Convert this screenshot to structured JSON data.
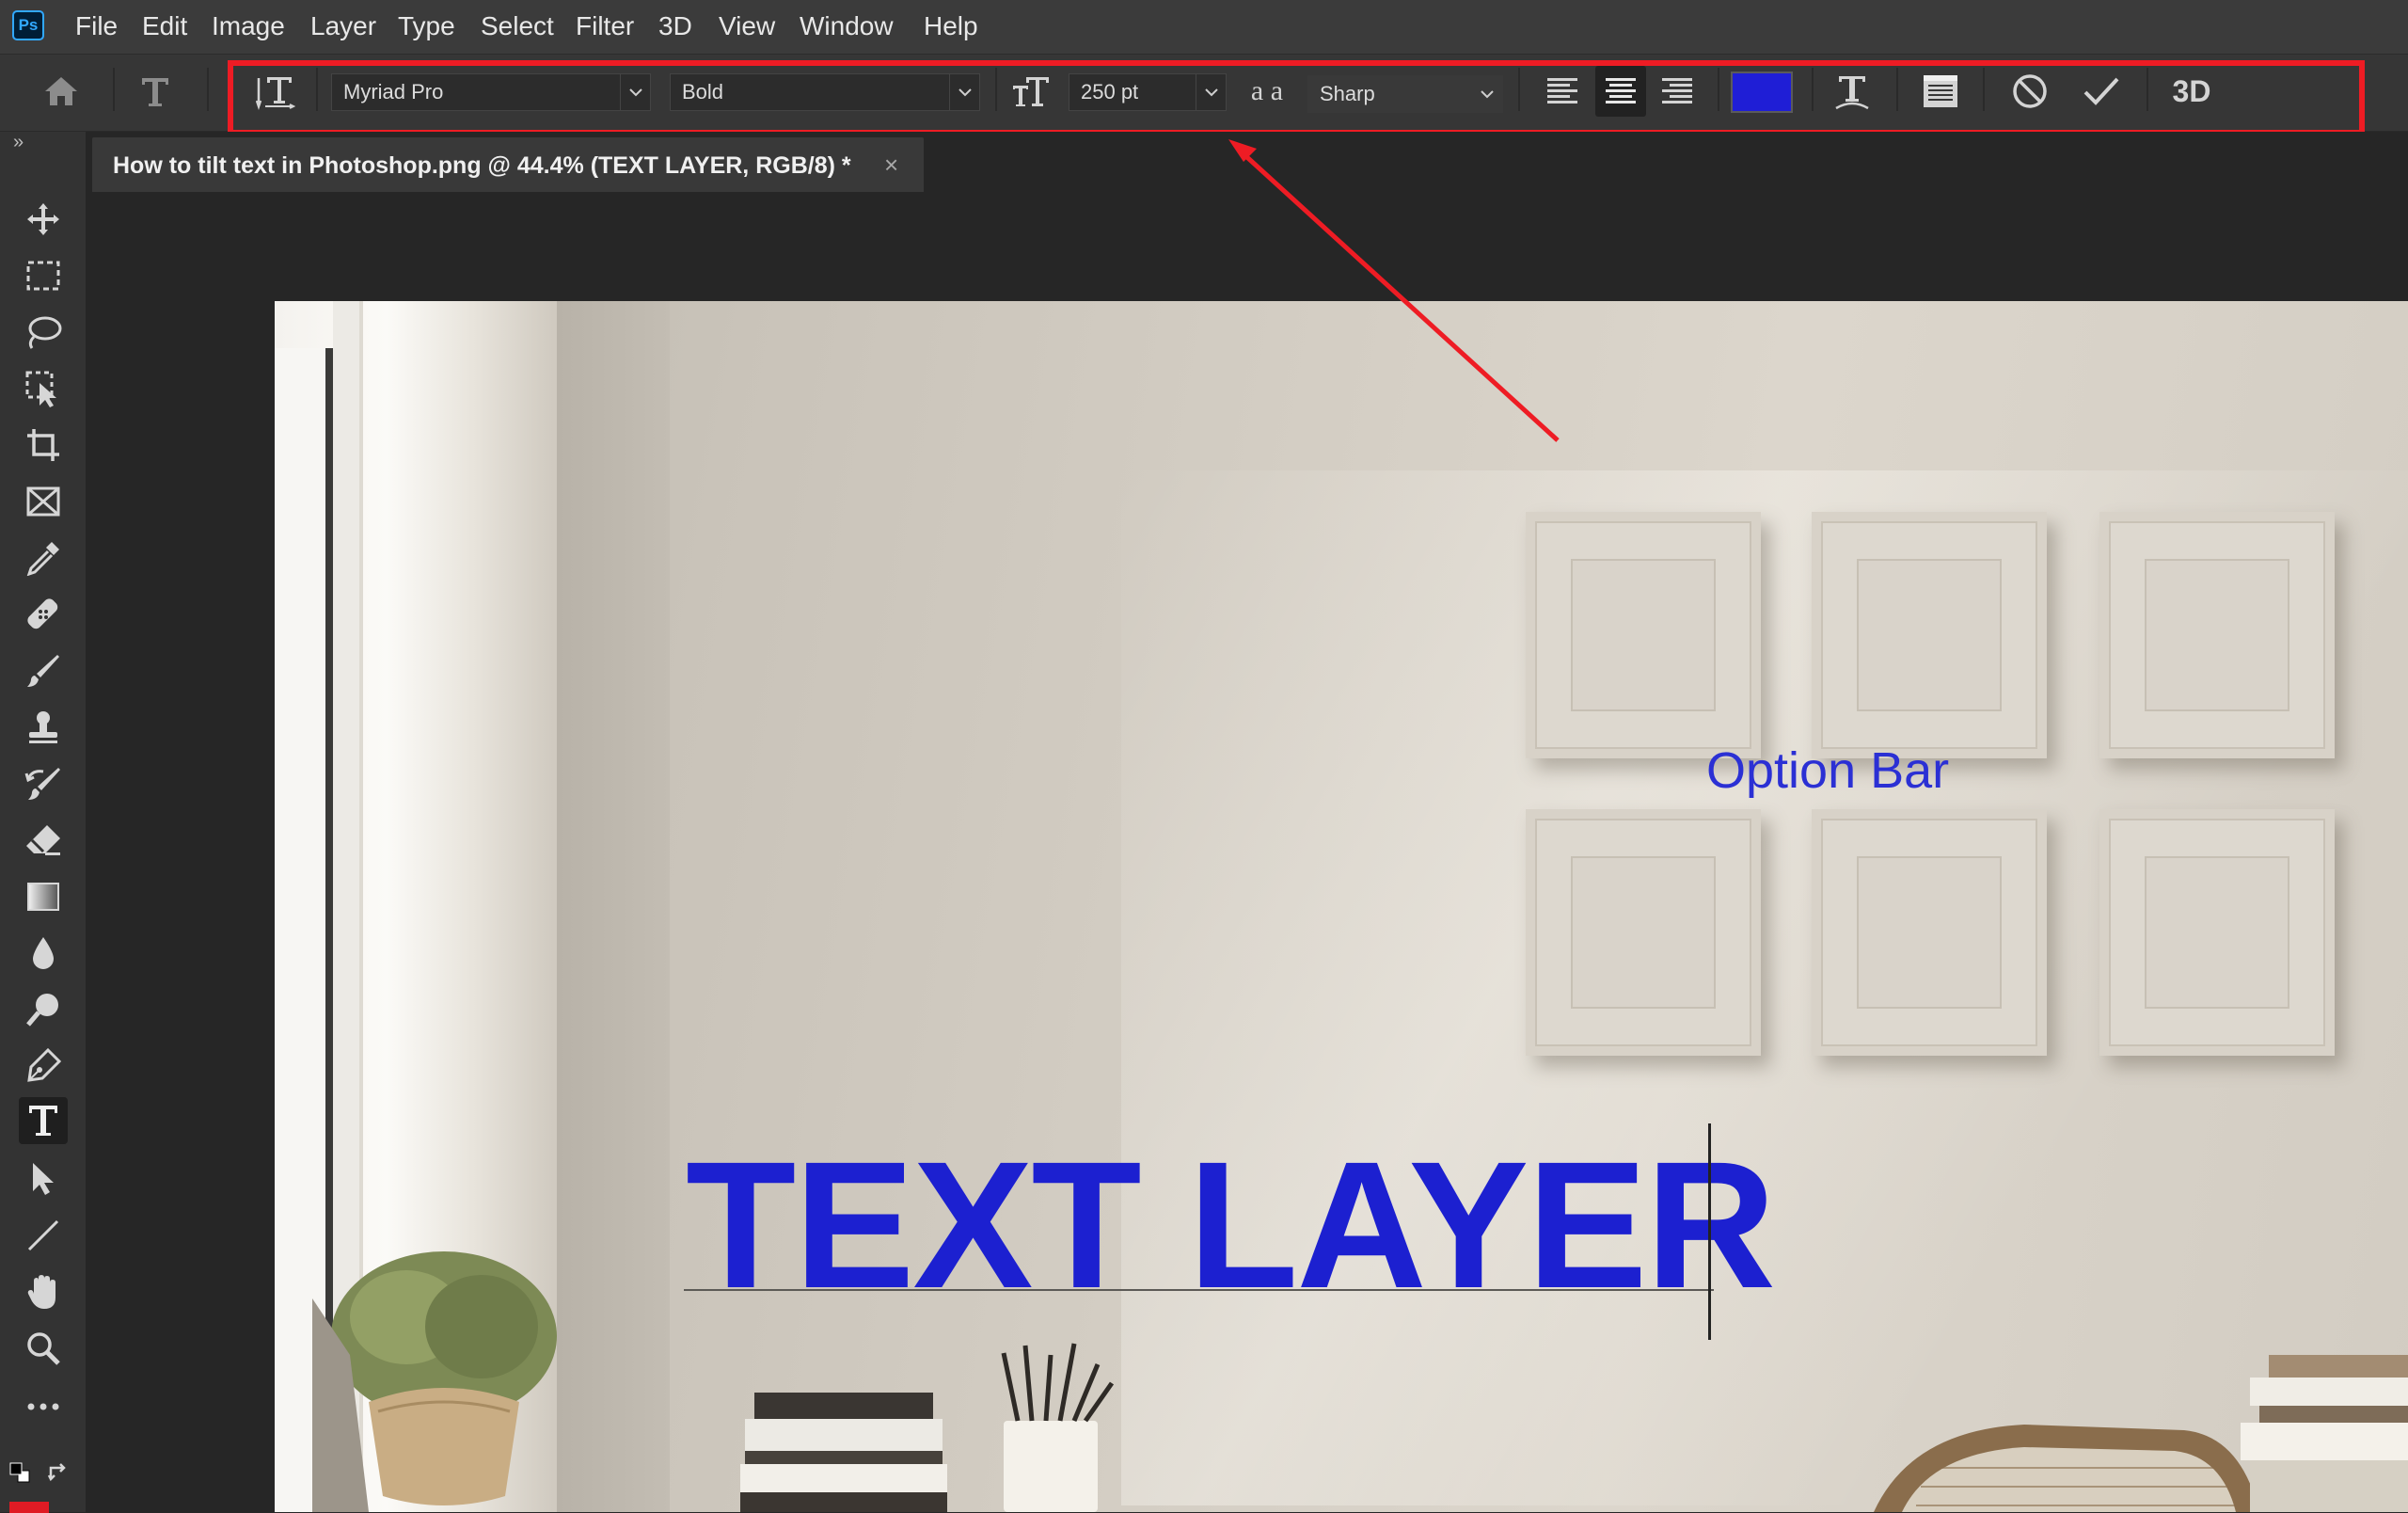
{
  "app": {
    "logo_text": "Ps"
  },
  "menu": {
    "items": [
      "File",
      "Edit",
      "Image",
      "Layer",
      "Type",
      "Select",
      "Filter",
      "3D",
      "View",
      "Window",
      "Help"
    ]
  },
  "options_bar": {
    "font_family": "Myriad Pro",
    "font_style": "Bold",
    "font_size": "250 pt",
    "antialias_icon_text": "a a",
    "antialias": "Sharp",
    "text_color": "#1f1ed6",
    "threed_label": "3D"
  },
  "tools": [
    "move-tool",
    "rectangular-marquee-tool",
    "lasso-tool",
    "object-selection-tool",
    "crop-tool",
    "frame-tool",
    "eyedropper-tool",
    "healing-brush-tool",
    "brush-tool",
    "clone-stamp-tool",
    "history-brush-tool",
    "eraser-tool",
    "gradient-tool",
    "blur-tool",
    "dodge-tool",
    "pen-tool",
    "type-tool",
    "path-selection-tool",
    "line-tool",
    "hand-tool",
    "zoom-tool",
    "more-tools"
  ],
  "document": {
    "tab_title": "How to tilt text in Photoshop.png @ 44.4% (TEXT LAYER, RGB/8) *",
    "close_glyph": "×"
  },
  "canvas": {
    "text_layer": "TEXT LAYER",
    "text_color": "#1c20d0"
  },
  "annotation": {
    "label": "Option Bar",
    "color": "#ee1c24"
  }
}
